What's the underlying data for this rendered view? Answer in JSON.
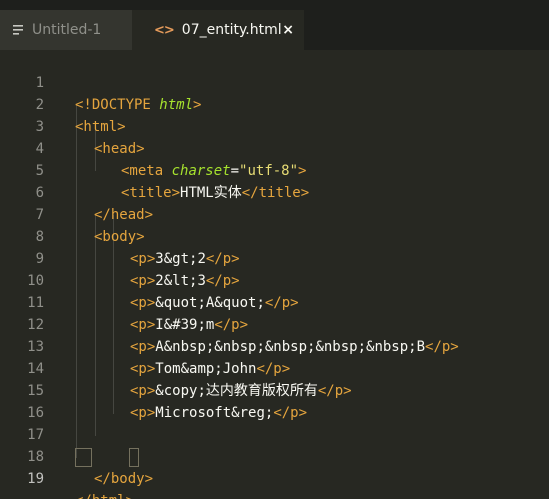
{
  "tabs": [
    {
      "label": "Untitled-1",
      "icon": "menu-lines-icon",
      "active": false
    },
    {
      "label": "07_entity.html",
      "icon": "code-brackets-icon",
      "active": true,
      "close": "×"
    }
  ],
  "gutter": [
    "1",
    "2",
    "3",
    "4",
    "5",
    "6",
    "7",
    "8",
    "9",
    "10",
    "11",
    "12",
    "13",
    "14",
    "15",
    "16",
    "17",
    "18",
    "19"
  ],
  "code": {
    "l1": {
      "open": "<!DOCTYPE",
      "attr": " html",
      "close": ">"
    },
    "l2": {
      "tag": "<html>"
    },
    "l3": {
      "tag": "<head>"
    },
    "l4": {
      "open": "<meta",
      "attr": " charset",
      "eq": "=",
      "val": "\"utf-8\"",
      "close": ">"
    },
    "l5": {
      "open": "<title>",
      "text": "HTML实体",
      "close": "</title>"
    },
    "l6": {
      "tag": "</head>"
    },
    "l7": {
      "tag": "<body>"
    },
    "l8": {
      "open": "<p>",
      "text": "3&gt;2",
      "close": "</p>"
    },
    "l9": {
      "open": "<p>",
      "text": "2&lt;3",
      "close": "</p>"
    },
    "l10": {
      "open": "<p>",
      "text": "&quot;A&quot;",
      "close": "</p>"
    },
    "l11": {
      "open": "<p>",
      "text": "I&#39;m",
      "close": "</p>"
    },
    "l12": {
      "open": "<p>",
      "text": "A&nbsp;&nbsp;&nbsp;&nbsp;&nbsp;B",
      "close": "</p>"
    },
    "l13": {
      "open": "<p>",
      "text": "Tom&amp;John",
      "close": "</p>"
    },
    "l14": {
      "open": "<p>",
      "text": "&copy;达内教育版权所有",
      "close": "</p>"
    },
    "l15": {
      "open": "<p>",
      "text": "Microsoft&reg;",
      "close": "</p>"
    },
    "l18": {
      "tag": "</body>"
    },
    "l19": {
      "open": "</",
      "name": "html",
      "close": ">"
    }
  }
}
